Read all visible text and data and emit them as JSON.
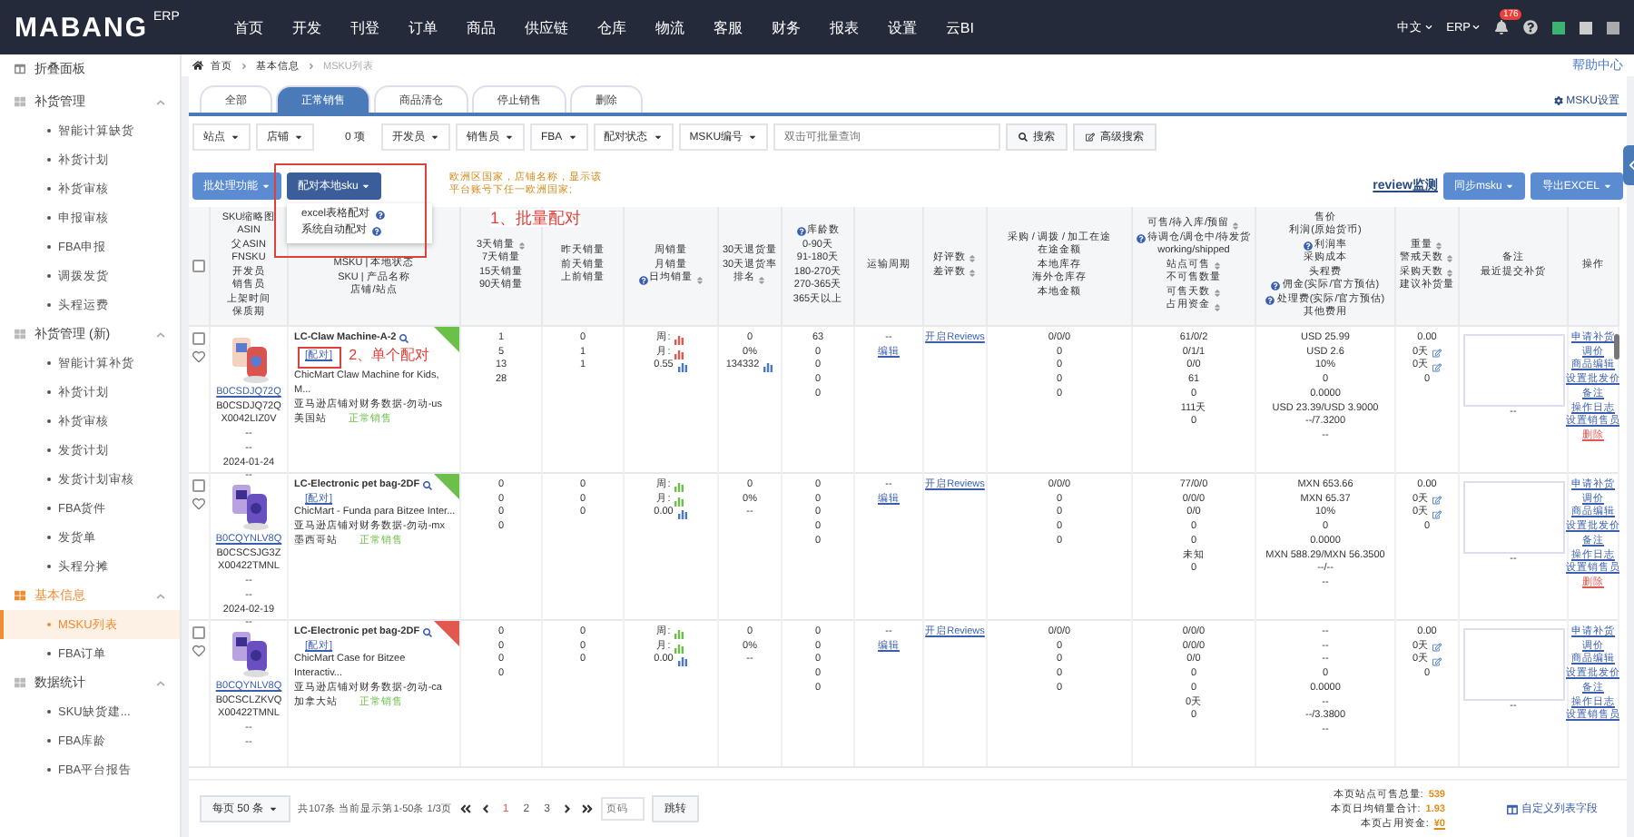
{
  "nav": {
    "logo": "MABANG",
    "logo_suffix": "ERP",
    "menu": [
      {
        "label": "首页",
        "selected": false
      },
      {
        "label": "开发",
        "selected": false
      },
      {
        "label": "刊登",
        "selected": false
      },
      {
        "label": "订单",
        "selected": false
      },
      {
        "label": "商品",
        "selected": false
      },
      {
        "label": "供应链",
        "selected": false
      },
      {
        "label": "仓库",
        "selected": false
      },
      {
        "label": "物流",
        "selected": false
      },
      {
        "label": "客服",
        "selected": false
      },
      {
        "label": "财务",
        "selected": false
      },
      {
        "label": "报表",
        "selected": false
      },
      {
        "label": "设置",
        "selected": false
      },
      {
        "label": "云BI",
        "selected": false
      }
    ],
    "language": "中文",
    "system": "ERP",
    "notification_count": "176"
  },
  "sidebar": {
    "collapse_label": "折叠面板",
    "groups": [
      {
        "label": "补货管理",
        "expanded": true,
        "active": false,
        "items": [
          {
            "label": "智能计算缺货",
            "selected": false
          },
          {
            "label": "补货计划",
            "selected": false
          },
          {
            "label": "补货审核",
            "selected": false
          },
          {
            "label": "申报审核",
            "selected": false
          },
          {
            "label": "FBA申报",
            "selected": false
          },
          {
            "label": "调拨发货",
            "selected": false
          },
          {
            "label": "头程运费",
            "selected": false
          }
        ]
      },
      {
        "label": "补货管理 (新)",
        "expanded": true,
        "active": false,
        "items": [
          {
            "label": "智能计算补货",
            "selected": false
          },
          {
            "label": "补货计划",
            "selected": false
          },
          {
            "label": "补货审核",
            "selected": false
          },
          {
            "label": "发货计划",
            "selected": false
          },
          {
            "label": "发货计划审核",
            "selected": false
          },
          {
            "label": "FBA货件",
            "selected": false
          },
          {
            "label": "发货单",
            "selected": false
          },
          {
            "label": "头程分摊",
            "selected": false
          }
        ]
      },
      {
        "label": "基本信息",
        "expanded": true,
        "active": true,
        "items": [
          {
            "label": "MSKU列表",
            "selected": true
          },
          {
            "label": "FBA订单",
            "selected": false
          }
        ]
      },
      {
        "label": "数据统计",
        "expanded": true,
        "active": false,
        "items": [
          {
            "label": "SKU缺货建...",
            "selected": false
          },
          {
            "label": "FBA库龄",
            "selected": false
          },
          {
            "label": "FBA平台报告",
            "selected": false
          }
        ]
      }
    ]
  },
  "breadcrumb": [
    "首页",
    "基本信息",
    "MSKU列表"
  ],
  "help_link": "帮助中心",
  "tabs": [
    {
      "label": "全部",
      "selected": false
    },
    {
      "label": "正常销售",
      "selected": true
    },
    {
      "label": "商品清仓",
      "selected": false
    },
    {
      "label": "停止销售",
      "selected": false
    },
    {
      "label": "删除",
      "selected": false
    }
  ],
  "settings_link": "MSKU设置",
  "filters": [
    {
      "label": "站点"
    },
    {
      "label": "店铺",
      "count": "0 项"
    },
    {
      "label": "开发员"
    },
    {
      "label": "销售员"
    },
    {
      "label": "FBA"
    },
    {
      "label": "配对状态"
    },
    {
      "label": "MSKU编号"
    }
  ],
  "search": {
    "placeholder": "双击可批量查询",
    "button": "搜索",
    "advanced": "高级搜索"
  },
  "actions": {
    "batch": "批处理功能",
    "pair": "配对本地sku",
    "notice": "欧洲区国家，店铺名称，显示该平台账号下任一欧洲国家;",
    "annotation": "1、批量配对",
    "review": "review监测",
    "sync": "同步msku",
    "export": "导出EXCEL"
  },
  "pair_menu": {
    "open": true,
    "items": [
      {
        "label": "excel表格配对",
        "help": true
      },
      {
        "label": "系统自动配对",
        "help": true
      }
    ]
  },
  "table": {
    "select_all": {
      "checked": false
    },
    "columns": [
      {
        "lines": [
          "SKU缩略图",
          "ASIN",
          "父ASIN",
          "FNSKU",
          "开发员",
          "销售员",
          "上架时间",
          "保质期"
        ]
      },
      {
        "lines": [
          "MSKU | 本地状态",
          "SKU | 产品名称",
          "店铺/站点"
        ]
      },
      {
        "lines": [
          {
            "text": "3天销量",
            "sort": true
          },
          "7天销量",
          "15天销量",
          "90天销量"
        ]
      },
      {
        "lines": [
          "昨天销量",
          "前天销量",
          "上前销量"
        ]
      },
      {
        "lines": [
          "周销量",
          "月销量",
          {
            "text": "日均销量",
            "help": true,
            "sort": true
          }
        ]
      },
      {
        "lines": [
          "30天退货量",
          "30天退货率",
          {
            "text": "排名",
            "sort": true
          }
        ]
      },
      {
        "lines": [
          {
            "text": "库龄数",
            "help": true
          },
          "0-90天",
          "91-180天",
          "180-270天",
          "270-365天",
          "365天以上"
        ]
      },
      {
        "lines": [
          "运输周期"
        ]
      },
      {
        "lines": [
          {
            "text": "好评数",
            "sort": true
          },
          {
            "text": "差评数",
            "sort": true
          }
        ]
      },
      {
        "lines": [
          "采购 / 调拨 / 加工在途",
          "在途金额",
          "本地库存",
          "海外仓库存",
          "本地金额"
        ]
      },
      {
        "lines": [
          {
            "text": "可售/待入库/预留",
            "sort": true
          },
          {
            "text": "待调仓/调仓中/待发货",
            "help": true
          },
          "working/shipped",
          {
            "text": "站点可售",
            "sort": true
          },
          "不可售数量",
          {
            "text": "可售天数",
            "sort": true
          },
          {
            "text": "占用资金",
            "sort": true
          }
        ]
      },
      {
        "lines": [
          "售价",
          "利润(原始货币)",
          {
            "text": "利润率",
            "help": true
          },
          "采购成本",
          "头程费",
          {
            "text": "佣金(实际/官方预估)",
            "help": true
          },
          {
            "text": "处理费(实际/官方预估)",
            "help": true
          },
          "其他费用"
        ]
      },
      {
        "lines": [
          {
            "text": "重量",
            "sort": true
          },
          {
            "text": "警戒天数",
            "sort": true
          },
          {
            "text": "采购天数",
            "sort": true
          },
          "建议补货量"
        ]
      },
      {
        "lines": [
          "备注",
          "最近提交补货"
        ]
      },
      {
        "lines": [
          "操作"
        ]
      }
    ],
    "rows": [
      {
        "checked": false,
        "favorite": false,
        "cells": [
          {
            "kind": "ids",
            "lines": [
              "B0CSDJQ72Q",
              "B0CSDJQ72Q",
              "X0042LIZ0V",
              "--",
              "--",
              "2024-01-24",
              "--"
            ]
          },
          {
            "kind": "product",
            "title": "LC-Claw Machine-A-2",
            "pair": "[配对]",
            "annotation": "2、单个配对",
            "name": "ChicMart Claw Machine for Kids, M...",
            "store": "亚马逊店铺对财务数据-勿动-us",
            "site": "美国站",
            "status": "正常销售",
            "color": "#6cc04a"
          },
          {
            "kind": "lines",
            "lines": [
              "1",
              "5",
              "13",
              "28"
            ]
          },
          {
            "kind": "lines",
            "lines": [
              "0",
              "1",
              "1"
            ]
          },
          {
            "kind": "lines",
            "lines": [
              {
                "text": "周:",
                "kind": "chart",
                "color": "#e0584f"
              },
              {
                "text": "月:",
                "kind": "chart",
                "color": "#e0584f"
              },
              {
                "text": "0.55",
                "kind": "chart",
                "color": "#4a78c8"
              }
            ]
          },
          {
            "kind": "lines",
            "lines": [
              "0",
              "0%",
              {
                "text": "134332",
                "kind": "chart",
                "color": "#4a78c8"
              }
            ]
          },
          {
            "kind": "lines",
            "lines": [
              "63",
              "0",
              "0",
              "0",
              "0"
            ]
          },
          {
            "kind": "lines",
            "lines": [
              "--",
              {
                "text": "编辑",
                "kind": "link"
              }
            ]
          },
          {
            "kind": "lines",
            "lines": [
              {
                "text": "开启Reviews",
                "kind": "link"
              }
            ]
          },
          {
            "kind": "lines",
            "lines": [
              "0/0/0",
              "0",
              "0",
              "0",
              "0"
            ]
          },
          {
            "kind": "lines",
            "lines": [
              "61/0/2",
              "0/1/1",
              "0/0",
              "61",
              "0",
              "111天",
              "0"
            ]
          },
          {
            "kind": "lines",
            "lines": [
              "USD 25.99",
              "USD 2.6",
              "10%",
              "0",
              "0.0000",
              "USD 23.39/USD 3.9000",
              "--/7.3200",
              "--"
            ]
          },
          {
            "kind": "lines",
            "lines": [
              "0.00",
              {
                "text": "0天",
                "kind": "edit"
              },
              {
                "text": "0天",
                "kind": "edit"
              },
              "0"
            ]
          },
          {
            "kind": "remark",
            "text": "--"
          },
          {
            "kind": "operations",
            "items": [
              {
                "label": "申请补货",
                "danger": false
              },
              {
                "label": "调价",
                "danger": false
              },
              {
                "label": "商品编辑",
                "danger": false
              },
              {
                "label": "设置批发价",
                "danger": false
              },
              {
                "label": "备注",
                "danger": false
              },
              {
                "label": "操作日志",
                "danger": false
              },
              {
                "label": "设置销售员",
                "danger": false
              },
              {
                "label": "删除",
                "danger": true
              }
            ]
          }
        ]
      },
      {
        "checked": false,
        "favorite": false,
        "cells": [
          {
            "kind": "ids",
            "lines": [
              "B0CQYNLV8Q",
              "B0CSCSJG3Z",
              "X00422TMNL",
              "--",
              "--",
              "2024-02-19",
              "--"
            ]
          },
          {
            "kind": "product",
            "title": "LC-Electronic pet bag-2DF",
            "pair": "[配对]",
            "name": "ChicMart - Funda para Bitzee Inter...",
            "store": "亚马逊店铺对财务数据-勿动-mx",
            "site": "墨西哥站",
            "status": "正常销售",
            "color": "#6cc04a"
          },
          {
            "kind": "lines",
            "lines": [
              "0",
              "0",
              "0",
              "0"
            ]
          },
          {
            "kind": "lines",
            "lines": [
              "0",
              "0",
              "0"
            ]
          },
          {
            "kind": "lines",
            "lines": [
              {
                "text": "周:",
                "kind": "chart",
                "color": "#6cc04a"
              },
              {
                "text": "月:",
                "kind": "chart",
                "color": "#6cc04a"
              },
              {
                "text": "0.00",
                "kind": "chart",
                "color": "#4a78c8"
              }
            ]
          },
          {
            "kind": "lines",
            "lines": [
              "0",
              "0%",
              "--"
            ]
          },
          {
            "kind": "lines",
            "lines": [
              "0",
              "0",
              "0",
              "0",
              "0"
            ]
          },
          {
            "kind": "lines",
            "lines": [
              "--",
              {
                "text": "编辑",
                "kind": "link"
              }
            ]
          },
          {
            "kind": "lines",
            "lines": [
              {
                "text": "开启Reviews",
                "kind": "link"
              }
            ]
          },
          {
            "kind": "lines",
            "lines": [
              "0/0/0",
              "0",
              "0",
              "0",
              "0"
            ]
          },
          {
            "kind": "lines",
            "lines": [
              "77/0/0",
              "0/0/0",
              "0/0",
              "0",
              "0",
              "未知",
              "0"
            ]
          },
          {
            "kind": "lines",
            "lines": [
              "MXN 653.66",
              "MXN 65.37",
              "10%",
              "0",
              "0.0000",
              "MXN 588.29/MXN 56.3500",
              "--/--",
              "--"
            ]
          },
          {
            "kind": "lines",
            "lines": [
              "0.00",
              {
                "text": "0天",
                "kind": "edit"
              },
              {
                "text": "0天",
                "kind": "edit"
              },
              "0"
            ]
          },
          {
            "kind": "remark",
            "text": "--"
          },
          {
            "kind": "operations",
            "items": [
              {
                "label": "申请补货",
                "danger": false
              },
              {
                "label": "调价",
                "danger": false
              },
              {
                "label": "商品编辑",
                "danger": false
              },
              {
                "label": "设置批发价",
                "danger": false
              },
              {
                "label": "备注",
                "danger": false
              },
              {
                "label": "操作日志",
                "danger": false
              },
              {
                "label": "设置销售员",
                "danger": false
              },
              {
                "label": "删除",
                "danger": true
              }
            ]
          }
        ]
      },
      {
        "checked": false,
        "favorite": false,
        "cells": [
          {
            "kind": "ids",
            "lines": [
              "B0CQYNLV8Q",
              "B0CSCLZKVQ",
              "X00422TMNL",
              "--",
              "--"
            ]
          },
          {
            "kind": "product",
            "title": "LC-Electronic pet bag-2DF",
            "pair": "[配对]",
            "name": "ChicMart Case for Bitzee Interactiv...",
            "store": "亚马逊店铺对财务数据-勿动-ca",
            "site": "加拿大站",
            "status": "正常销售",
            "color": "#e0584f"
          },
          {
            "kind": "lines",
            "lines": [
              "0",
              "0",
              "0",
              "0"
            ]
          },
          {
            "kind": "lines",
            "lines": [
              "0",
              "0",
              "0"
            ]
          },
          {
            "kind": "lines",
            "lines": [
              {
                "text": "周:",
                "kind": "chart",
                "color": "#6cc04a"
              },
              {
                "text": "月:",
                "kind": "chart",
                "color": "#6cc04a"
              },
              {
                "text": "0.00",
                "kind": "chart",
                "color": "#4a78c8"
              }
            ]
          },
          {
            "kind": "lines",
            "lines": [
              "0",
              "0%",
              "--"
            ]
          },
          {
            "kind": "lines",
            "lines": [
              "0",
              "0",
              "0",
              "0",
              "0"
            ]
          },
          {
            "kind": "lines",
            "lines": [
              "--",
              {
                "text": "编辑",
                "kind": "link"
              }
            ]
          },
          {
            "kind": "lines",
            "lines": [
              {
                "text": "开启Reviews",
                "kind": "link"
              }
            ]
          },
          {
            "kind": "lines",
            "lines": [
              "0/0/0",
              "0",
              "0",
              "0",
              "0"
            ]
          },
          {
            "kind": "lines",
            "lines": [
              "0/0/0",
              "0/0/0",
              "0/0",
              "0",
              "0",
              "0天",
              "0"
            ]
          },
          {
            "kind": "lines",
            "lines": [
              "--",
              "--",
              "--",
              "0",
              "0.0000",
              "--",
              "--/3.3800",
              "--"
            ]
          },
          {
            "kind": "lines",
            "lines": [
              "0.00",
              {
                "text": "0天",
                "kind": "edit"
              },
              {
                "text": "0天",
                "kind": "edit"
              },
              "0"
            ]
          },
          {
            "kind": "remark",
            "text": "--"
          },
          {
            "kind": "operations",
            "items": [
              {
                "label": "申请补货",
                "danger": false
              },
              {
                "label": "调价",
                "danger": false
              },
              {
                "label": "商品编辑",
                "danger": false
              },
              {
                "label": "设置批发价",
                "danger": false
              },
              {
                "label": "备注",
                "danger": false
              },
              {
                "label": "操作日志",
                "danger": false
              },
              {
                "label": "设置销售员",
                "danger": false
              }
            ]
          }
        ]
      }
    ]
  },
  "footer": {
    "page_size": "每页 50 条",
    "summary": "共107条 当前显示第1-50条 1/3页",
    "pages": [
      {
        "label": "1",
        "selected": true
      },
      {
        "label": "2",
        "selected": false
      },
      {
        "label": "3",
        "selected": false
      }
    ],
    "page_placeholder": "页码",
    "jump": "跳转",
    "stats": [
      {
        "label": "本页站点可售总量:",
        "value": "539"
      },
      {
        "label": "本页日均销量合计:",
        "value": "1.93"
      },
      {
        "label": "本页占用资金:",
        "value": "¥0"
      }
    ],
    "custom_fields": "自定义列表字段"
  }
}
